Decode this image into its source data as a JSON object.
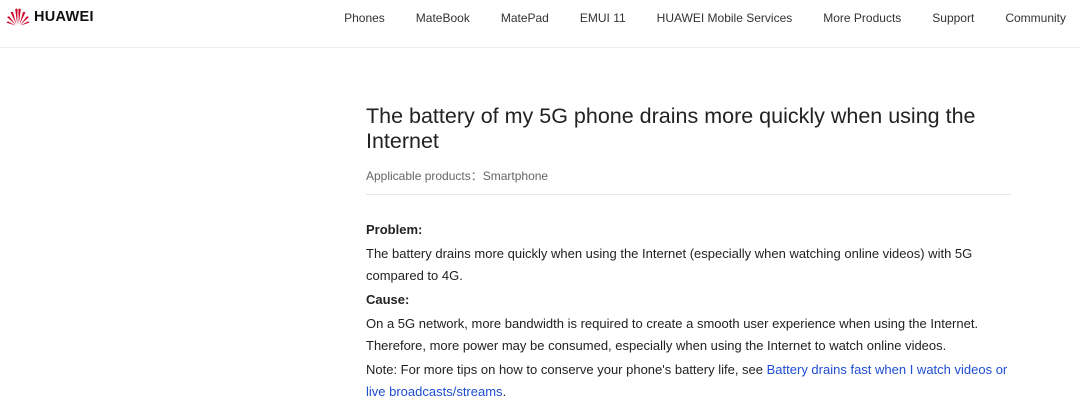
{
  "brand": {
    "name": "HUAWEI",
    "color": "#cf0a2c"
  },
  "nav": {
    "items": [
      "Phones",
      "MateBook",
      "MatePad",
      "EMUI 11",
      "HUAWEI Mobile Services",
      "More Products",
      "Support",
      "Community"
    ]
  },
  "article": {
    "title": "The battery of my 5G phone drains more quickly when using the Internet",
    "applicable_products": "Applicable products：Smartphone",
    "problem_heading": "Problem:",
    "problem_text": "The battery drains more quickly when using the Internet (especially when watching online videos) with 5G compared to 4G.",
    "cause_heading": "Cause:",
    "cause_text": "On a 5G network, more bandwidth is required to create a smooth user experience when using the Internet. Therefore, more power may be consumed, especially when using the Internet to watch online videos.",
    "note_prefix": "Note: For more tips on how to conserve your phone's battery life, see ",
    "note_link": "Battery drains fast when I watch videos or live broadcasts/streams",
    "note_suffix": ".",
    "link_color": "#1d4dd2"
  }
}
